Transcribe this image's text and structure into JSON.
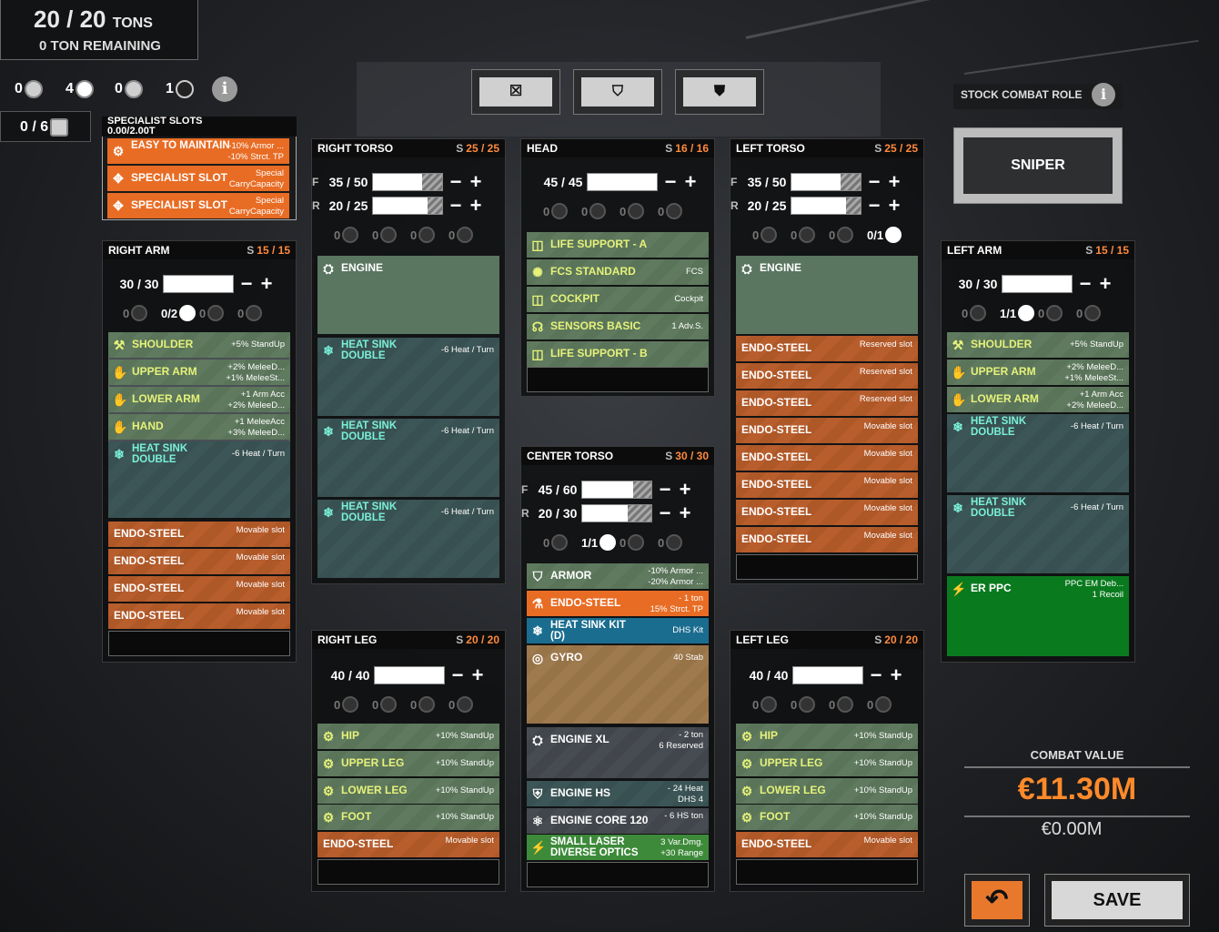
{
  "tonnage": {
    "current": "20",
    "max": "20",
    "unit": "TONS",
    "remaining": "0 TON REMAINING"
  },
  "counters": {
    "c1": "0",
    "c2": "4",
    "c3": "0",
    "c4": "1",
    "specialist": "0 / 6"
  },
  "top_buttons": [
    "☒",
    "⛉",
    "⛊"
  ],
  "role": {
    "label": "STOCK COMBAT ROLE",
    "value": "SNIPER"
  },
  "specialist": {
    "title": "SPECIALIST SLOTS",
    "tons": "0.00/2.00T",
    "items": [
      {
        "name": "EASY TO MAINTAIN",
        "tag": "-10% Armor ...\n-10% Strct. TP"
      },
      {
        "name": "SPECIALIST SLOT",
        "tag": "Special\nCarryCapacity"
      },
      {
        "name": "SPECIALIST SLOT",
        "tag": "Special\nCarryCapacity"
      }
    ]
  },
  "right_arm": {
    "title": "RIGHT ARM",
    "s": "S",
    "slots": "15 / 15",
    "armor": "30 / 30",
    "hard": [
      "0",
      "0/2",
      "0",
      "0"
    ],
    "items": [
      {
        "name": "SHOULDER",
        "tag": "+5% StandUp"
      },
      {
        "name": "UPPER ARM",
        "tag": "+2% MeleeD...\n+1% MeleeSt..."
      },
      {
        "name": "LOWER ARM",
        "tag": "+1 Arm Acc\n+2% MeleeD..."
      },
      {
        "name": "HAND",
        "tag": "+1 MeleeAcc\n+3% MeleeD..."
      },
      {
        "name": "HEAT SINK\nDOUBLE",
        "tag": "-6 Heat / Turn"
      }
    ],
    "endo": [
      "ENDO-STEEL",
      "ENDO-STEEL",
      "ENDO-STEEL",
      "ENDO-STEEL"
    ],
    "endo_tag": "Movable slot"
  },
  "right_torso": {
    "title": "RIGHT TORSO",
    "s": "S",
    "slots": "25 / 25",
    "front": "35 / 50",
    "rear": "20 / 25",
    "hard": [
      "0",
      "0",
      "0",
      "0"
    ],
    "items": [
      {
        "name": "ENGINE",
        "tag": ""
      },
      {
        "name": "HEAT SINK\nDOUBLE",
        "tag": "-6 Heat / Turn"
      },
      {
        "name": "HEAT SINK\nDOUBLE",
        "tag": "-6 Heat / Turn"
      },
      {
        "name": "HEAT SINK\nDOUBLE",
        "tag": "-6 Heat / Turn"
      }
    ]
  },
  "head": {
    "title": "HEAD",
    "s": "S",
    "slots": "16 / 16",
    "armor": "45 / 45",
    "hard": [
      "0",
      "0",
      "0",
      "0"
    ],
    "items": [
      {
        "name": "LIFE SUPPORT - A",
        "tag": ""
      },
      {
        "name": "FCS STANDARD",
        "tag": "FCS"
      },
      {
        "name": "COCKPIT",
        "tag": "Cockpit"
      },
      {
        "name": "SENSORS BASIC",
        "tag": "1 Adv.S."
      },
      {
        "name": "LIFE SUPPORT - B",
        "tag": ""
      }
    ]
  },
  "center_torso": {
    "title": "CENTER TORSO",
    "s": "S",
    "slots": "30 / 30",
    "front": "45 / 60",
    "rear": "20 / 30",
    "hard": [
      "0",
      "1/1",
      "0",
      "0"
    ],
    "items": [
      {
        "name": "ARMOR",
        "tag": "-10% Armor ...\n-20% Armor ..."
      },
      {
        "name": "ENDO-STEEL",
        "tag": "- 1 ton\n15% Strct. TP"
      },
      {
        "name": "HEAT SINK KIT\n(D)",
        "tag": "DHS Kit"
      },
      {
        "name": "GYRO",
        "tag": "40 Stab"
      },
      {
        "name": "ENGINE XL",
        "tag": "- 2 ton\n6 Reserved"
      },
      {
        "name": "ENGINE HS",
        "tag": "- 24 Heat\nDHS 4"
      },
      {
        "name": "ENGINE CORE 120",
        "tag": "- 6 HS ton"
      },
      {
        "name": "SMALL LASER\nDIVERSE OPTICS",
        "tag": "3 Var.Dmg.\n+30 Range"
      }
    ]
  },
  "left_torso": {
    "title": "LEFT TORSO",
    "s": "S",
    "slots": "25 / 25",
    "front": "35 / 50",
    "rear": "20 / 25",
    "hard": [
      "0",
      "0",
      "0",
      "0/1"
    ],
    "items": [
      {
        "name": "ENGINE",
        "tag": ""
      },
      {
        "name": "ENDO-STEEL",
        "tag": "Reserved slot"
      },
      {
        "name": "ENDO-STEEL",
        "tag": "Reserved slot"
      },
      {
        "name": "ENDO-STEEL",
        "tag": "Reserved slot"
      },
      {
        "name": "ENDO-STEEL",
        "tag": "Movable slot"
      },
      {
        "name": "ENDO-STEEL",
        "tag": "Movable slot"
      },
      {
        "name": "ENDO-STEEL",
        "tag": "Movable slot"
      },
      {
        "name": "ENDO-STEEL",
        "tag": "Movable slot"
      },
      {
        "name": "ENDO-STEEL",
        "tag": "Movable slot"
      }
    ]
  },
  "left_arm": {
    "title": "LEFT ARM",
    "s": "S",
    "slots": "15 / 15",
    "armor": "30 / 30",
    "hard": [
      "0",
      "1/1",
      "0",
      "0"
    ],
    "items": [
      {
        "name": "SHOULDER",
        "tag": "+5% StandUp"
      },
      {
        "name": "UPPER ARM",
        "tag": "+2% MeleeD...\n+1% MeleeSt..."
      },
      {
        "name": "LOWER ARM",
        "tag": "+1 Arm Acc\n+2% MeleeD..."
      },
      {
        "name": "HEAT SINK\nDOUBLE",
        "tag": "-6 Heat / Turn"
      },
      {
        "name": "HEAT SINK\nDOUBLE",
        "tag": "-6 Heat / Turn"
      },
      {
        "name": "ER PPC",
        "tag": "PPC EM Deb...\n1 Recoil"
      }
    ]
  },
  "right_leg": {
    "title": "RIGHT LEG",
    "s": "S",
    "slots": "20 / 20",
    "armor": "40 / 40",
    "hard": [
      "0",
      "0",
      "0",
      "0"
    ],
    "items": [
      {
        "name": "HIP",
        "tag": "+10% StandUp"
      },
      {
        "name": "UPPER LEG",
        "tag": "+10% StandUp"
      },
      {
        "name": "LOWER LEG",
        "tag": "+10% StandUp"
      },
      {
        "name": "FOOT",
        "tag": "+10% StandUp"
      },
      {
        "name": "ENDO-STEEL",
        "tag": "Movable slot"
      }
    ]
  },
  "left_leg": {
    "title": "LEFT LEG",
    "s": "S",
    "slots": "20 / 20",
    "armor": "40 / 40",
    "hard": [
      "0",
      "0",
      "0",
      "0"
    ],
    "items": [
      {
        "name": "HIP",
        "tag": "+10% StandUp"
      },
      {
        "name": "UPPER LEG",
        "tag": "+10% StandUp"
      },
      {
        "name": "LOWER LEG",
        "tag": "+10% StandUp"
      },
      {
        "name": "FOOT",
        "tag": "+10% StandUp"
      },
      {
        "name": "ENDO-STEEL",
        "tag": "Movable slot"
      }
    ]
  },
  "combat_value": {
    "label": "COMBAT VALUE",
    "value": "11.30M",
    "delta": "0.00M",
    "currency": "€"
  },
  "buttons": {
    "undo": "↶",
    "save": "SAVE"
  },
  "labels": {
    "front": "F",
    "rear": "R",
    "minus": "−",
    "plus": "+",
    "info": "i"
  }
}
